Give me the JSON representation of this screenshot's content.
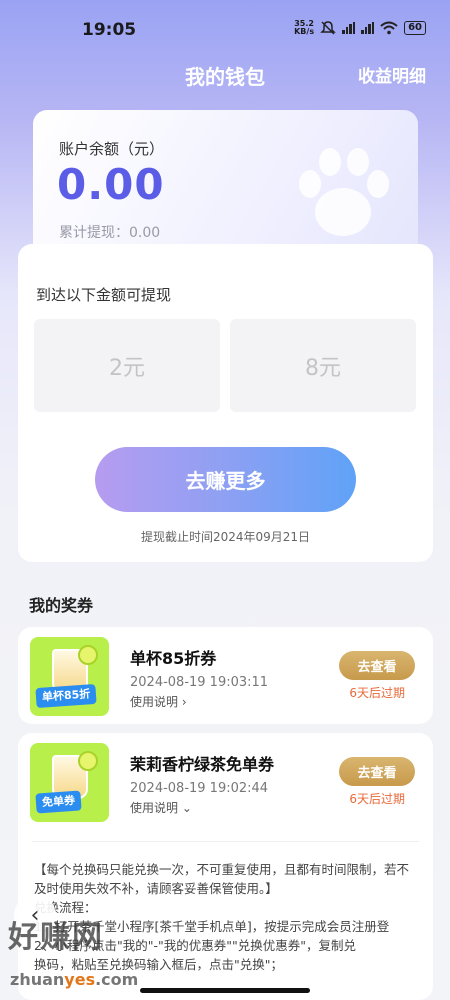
{
  "status_bar": {
    "time": "19:05",
    "net_speed_value": "35.2",
    "net_speed_unit": "KB/s",
    "battery": "60",
    "icons": [
      "mute-icon",
      "signal-icon",
      "signal-icon",
      "wifi-icon",
      "battery-icon"
    ]
  },
  "header": {
    "title": "我的钱包",
    "link": "收益明细"
  },
  "balance": {
    "label": "账户余额（元）",
    "value": "0.00",
    "withdrawn": "累计提现：0.00"
  },
  "withdraw": {
    "title": "到达以下金额可提现",
    "amounts": [
      "2元",
      "8元"
    ],
    "earn_button": "去赚更多",
    "deadline": "提现截止时间2024年09月21日"
  },
  "coupons": {
    "section_title": "我的奖券",
    "items": [
      {
        "name": "单杯85折券",
        "date": "2024-08-19 19:03:11",
        "usage": "使用说明",
        "usage_icon": "chevron-right-icon",
        "button": "去查看",
        "expire": "6天后过期",
        "thumb_tag": "单杯85折"
      },
      {
        "name": "茉莉香柠绿茶免单券",
        "date": "2024-08-19 19:02:44",
        "usage": "使用说明",
        "usage_icon": "chevron-down-icon",
        "button": "去查看",
        "expire": "6天后过期",
        "thumb_tag": "免单券"
      }
    ],
    "description": [
      "【每个兑换码只能兑换一次，不可重复使用，且都有时间限制，若不及时使用失效不补，请顾客妥善保管使用。】",
      "兑换流程：",
      "1、打开茶千堂小程序[茶千堂手机点单]，按提示完成会员注册登",
      "2、小程序点击\"我的\"-\"我的优惠券\"\"兑换优惠券\"，复制兑",
      "换码，粘贴至兑换码输入框后，点击\"兑换\"；"
    ]
  },
  "watermark": {
    "text": "好赚网",
    "url_pre": "zhuan",
    "url_hl": "yes",
    "url_post": ".com"
  },
  "colors": {
    "accent": "#5b5de7",
    "button_gradient_start": "#b69cf0",
    "button_gradient_end": "#5fa2f7",
    "gold": "#c79a4c",
    "expire": "#e86a3a"
  }
}
